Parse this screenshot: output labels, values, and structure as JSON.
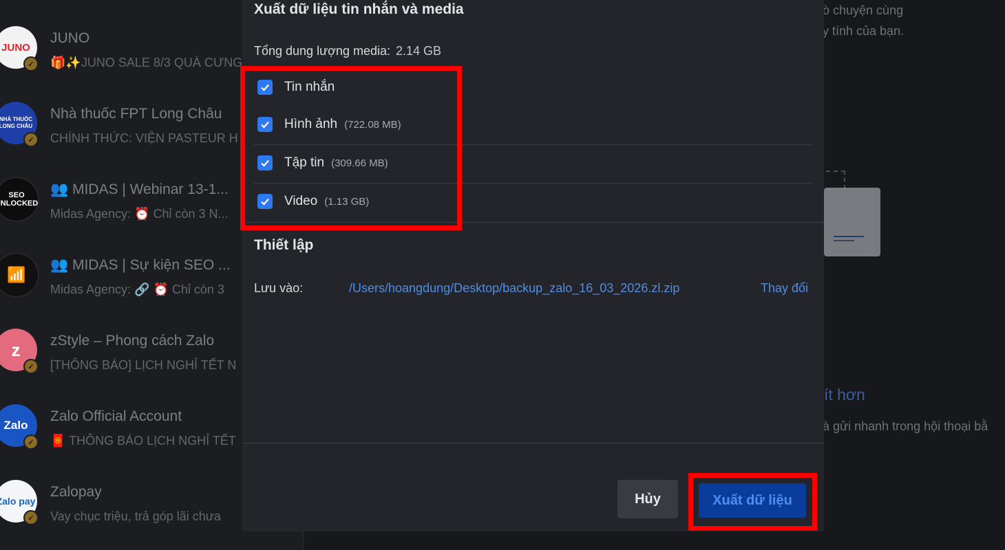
{
  "chat_list": [
    {
      "name": "JUNO",
      "preview": "🎁✨JUNO SALE 8/3 QUÀ CƯNG",
      "avatar_text": "JUNO",
      "avatar_bg": "#f2f2f2",
      "avatar_fg": "#d9262c"
    },
    {
      "name": "Nhà thuốc FPT Long Châu",
      "preview": "CHÍNH THỨC: VIỆN PASTEUR H",
      "avatar_text": "NHÀ THUỐC LONG CHÂU",
      "avatar_bg": "#1f3fa8",
      "avatar_fg": "#ffffff"
    },
    {
      "name": "👥 MIDAS | Webinar 13-1...",
      "preview": "Midas Agency: ⏰ Chỉ còn 3 N...",
      "avatar_text": "SEO UNLOCKED",
      "avatar_bg": "#0d0d0d",
      "avatar_fg": "#ffffff"
    },
    {
      "name": "👥 MIDAS | Sự kiện SEO ...",
      "preview": "Midas Agency: 🔗 ⏰ Chỉ còn 3",
      "avatar_text": "📶",
      "avatar_bg": "#111111",
      "avatar_fg": "#d4a52a"
    },
    {
      "name": "zStyle – Phong cách Zalo",
      "preview": "[THÔNG BÁO] LỊCH NGHỈ TẾT N",
      "avatar_text": "z",
      "avatar_bg": "#e36b7d",
      "avatar_fg": "#ffffff"
    },
    {
      "name": "Zalo Official Account",
      "preview": "🧧 THÔNG BÁO LỊCH NGHỈ TẾT",
      "avatar_text": "Zalo",
      "avatar_bg": "#1a55c4",
      "avatar_fg": "#ffffff"
    },
    {
      "name": "Zalopay",
      "preview": "Vay chục triệu, trả góp lãi chưa",
      "avatar_text": "Zalo pay",
      "avatar_bg": "#f4f5f7",
      "avatar_fg": "#1565c0"
    }
  ],
  "background": {
    "line1": "ò chuyện cùng",
    "line2": "y tính của bạn.",
    "link": "ít hơn",
    "line3": "à gửi nhanh trong hội thoại bằ"
  },
  "modal": {
    "title": "Xuất dữ liệu tin nhắn và media",
    "total_label": "Tổng dung lượng media:",
    "total_value": "2.14 GB",
    "options": [
      {
        "label": "Tin nhắn",
        "size": "",
        "checked": true
      },
      {
        "label": "Hình ảnh",
        "size": "(722.08 MB)",
        "checked": true
      },
      {
        "label": "Tập tin",
        "size": "(309.66 MB)",
        "checked": true
      },
      {
        "label": "Video",
        "size": "(1.13 GB)",
        "checked": true
      }
    ],
    "settings_title": "Thiết lập",
    "save_label": "Lưu vào:",
    "save_path": "/Users/hoangdung/Desktop/backup_zalo_16_03_2026.zl.zip",
    "change_label": "Thay đổi",
    "cancel_label": "Hủy",
    "export_label": "Xuất dữ liệu"
  },
  "colors": {
    "accent": "#2e78f0",
    "highlight": "#ff0000",
    "modal_bg": "#23252b",
    "link": "#4f8de6"
  }
}
